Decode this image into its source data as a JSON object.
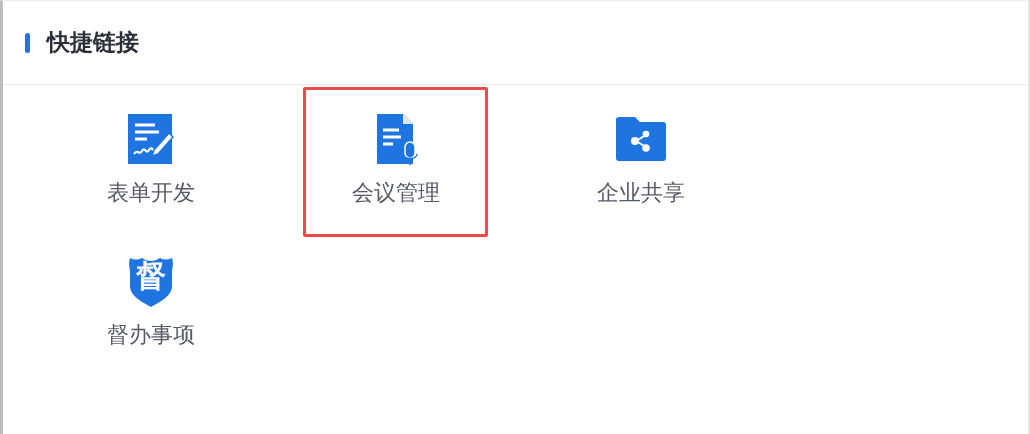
{
  "panel": {
    "title": "快捷链接"
  },
  "links": [
    {
      "kind": "form",
      "label": "表单开发",
      "highlighted": false
    },
    {
      "kind": "meeting",
      "label": "会议管理",
      "highlighted": true
    },
    {
      "kind": "share",
      "label": "企业共享",
      "highlighted": false
    },
    {
      "kind": "badge",
      "label": "督办事项",
      "icon_text": "督",
      "highlighted": false
    }
  ]
}
